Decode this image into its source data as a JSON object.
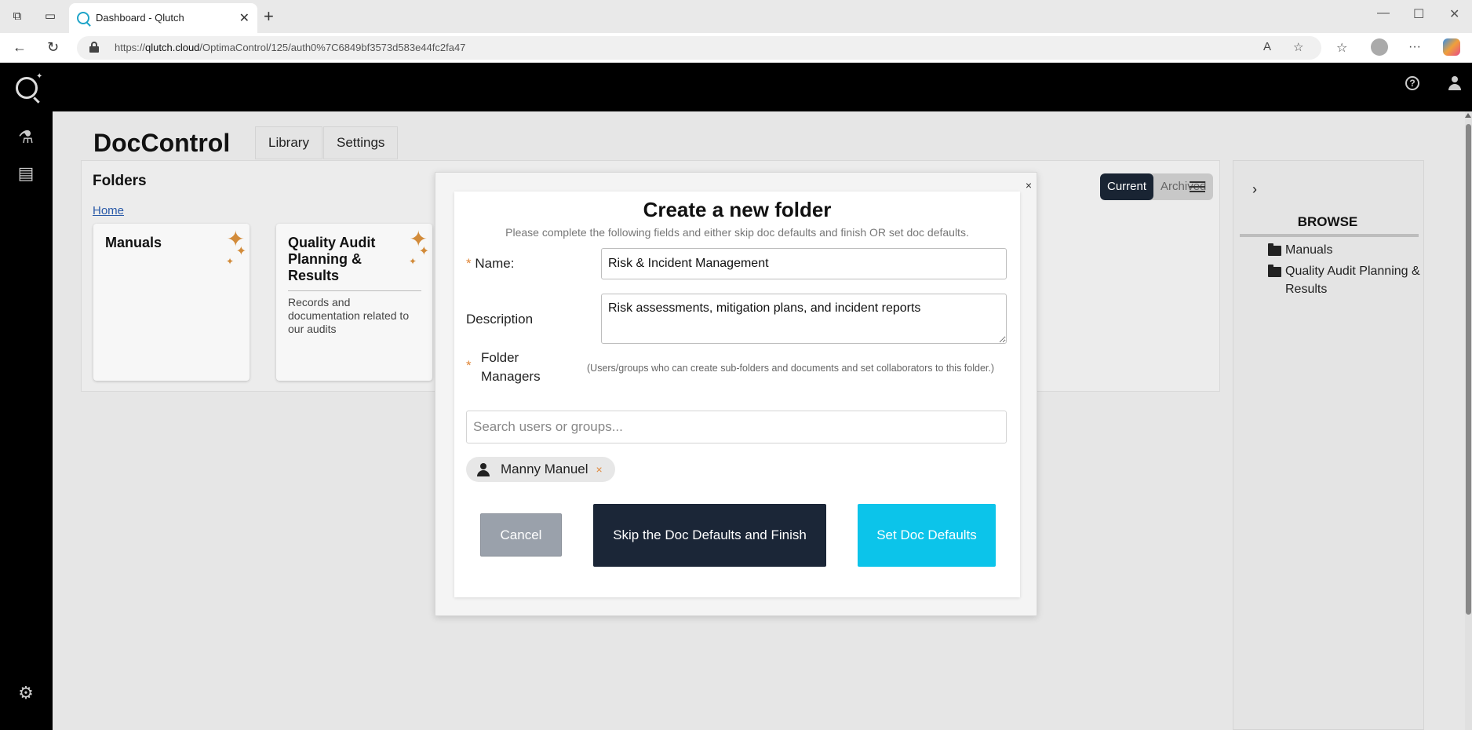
{
  "browser": {
    "tab_title": "Dashboard - Qlutch",
    "url_prefix": "https://",
    "url_host": "qlutch.cloud",
    "url_path": "/OptimaControl/125/auth0%7C6849bf3573d583e44fc2fa47"
  },
  "page": {
    "title": "DocControl",
    "tabs": [
      "Library",
      "Settings"
    ]
  },
  "folders": {
    "heading": "Folders",
    "breadcrumb": "Home",
    "cards": [
      {
        "name": "Manuals",
        "description": ""
      },
      {
        "name": "Quality Audit Planning & Results",
        "description": "Records and documentation related to our audits"
      }
    ],
    "segments": {
      "current": "Current",
      "archived": "Archived"
    }
  },
  "browse": {
    "title": "BROWSE",
    "items": [
      "Manuals",
      "Quality Audit Planning & Results"
    ]
  },
  "modal": {
    "close": "×",
    "title": "Create a new folder",
    "subtitle": "Please complete the following fields and either skip doc defaults and finish OR set doc defaults.",
    "required_mark": "*",
    "name_label": "Name:",
    "name_value": "Risk & Incident Management",
    "description_label": "Description",
    "description_value": "Risk assessments, mitigation plans, and incident reports",
    "managers_label_1": "Folder",
    "managers_label_2": "Managers",
    "managers_hint": "(Users/groups who can create sub-folders and documents and set collaborators to this folder.)",
    "search_placeholder": "Search users or groups...",
    "chip_name": "Manny Manuel",
    "chip_remove": "×",
    "cancel_label": "Cancel",
    "skip_label": "Skip the Doc Defaults and Finish",
    "set_label": "Set Doc Defaults"
  }
}
